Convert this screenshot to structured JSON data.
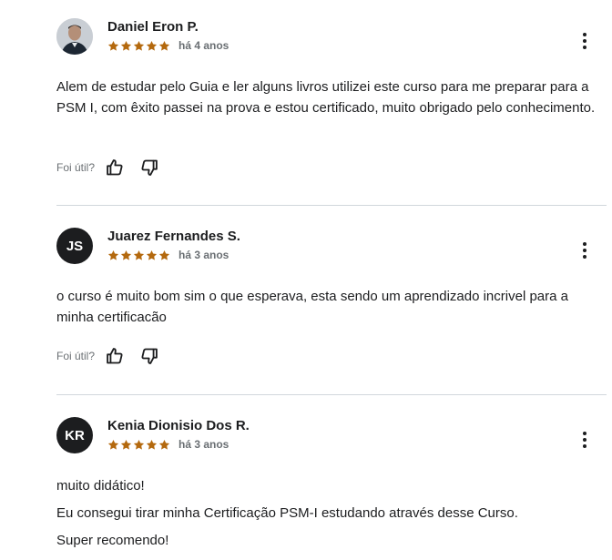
{
  "reviews": [
    {
      "name": "Daniel Eron P.",
      "avatar_initials": "",
      "time": "há 4 anos",
      "rating": 5,
      "paragraphs": [
        "Alem de estudar pelo Guia e ler alguns livros utilizei este curso para me preparar para a PSM I, com êxito passei na prova e estou certificado, muito obrigado pelo conhecimento."
      ],
      "helpful_label": "Foi útil?"
    },
    {
      "name": "Juarez Fernandes S.",
      "avatar_initials": "JS",
      "time": "há 3 anos",
      "rating": 5,
      "paragraphs": [
        "o curso é muito bom sim o que esperava, esta sendo um aprendizado incrivel para a minha certificacão"
      ],
      "helpful_label": "Foi útil?"
    },
    {
      "name": "Kenia Dionisio Dos R.",
      "avatar_initials": "KR",
      "time": "há 3 anos",
      "rating": 5,
      "paragraphs": [
        "muito didático!",
        "Eu consegui tirar minha Certificação PSM-I estudando através desse Curso.",
        "Super recomendo!"
      ],
      "helpful_label": ""
    }
  ],
  "colors": {
    "star": "#b4690e",
    "text": "#1c1d1f",
    "muted": "#6a6f73",
    "divider": "#d1d7dc"
  },
  "icons": {
    "more": "kebab-icon",
    "like": "thumbs-up-icon",
    "dislike": "thumbs-down-icon",
    "star": "star-icon"
  }
}
